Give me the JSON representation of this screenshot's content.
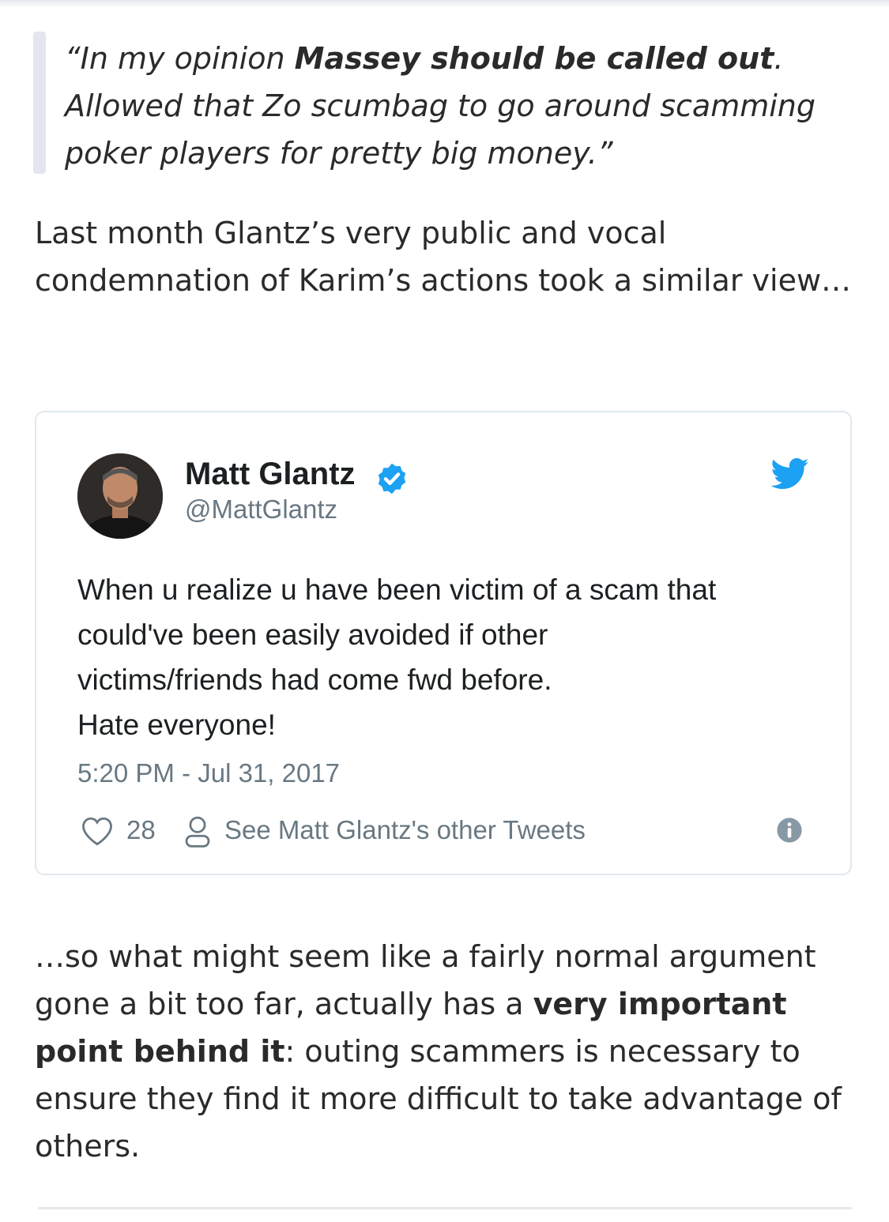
{
  "quote": {
    "open": "“In my opinion ",
    "bold": "Massey should be called out",
    "rest": ". Allowed that Zo scumbag to go around scamming poker players for pretty big money.”"
  },
  "para1": "Last month Glantz’s very public and vocal condemnation of Karim’s actions took a similar view…",
  "tweet": {
    "author_name": "Matt Glantz",
    "handle": "@MattGlantz",
    "lines": [
      "When u realize u have been victim of a scam that",
      "could've been easily avoided if other",
      "victims/friends had come fwd before.",
      "Hate everyone!"
    ],
    "timestamp": "5:20 PM - Jul 31, 2017",
    "like_count": "28",
    "other_tweets_label": "See Matt Glantz's other Tweets",
    "icons": {
      "verified": "verified-badge-icon",
      "brand": "twitter-bird-icon",
      "like": "heart-icon",
      "profile": "person-icon",
      "info": "info-icon"
    }
  },
  "para2": {
    "part1": "…so what might seem like a fairly normal argument gone a bit too far, actually has a ",
    "bold": "very important point behind it",
    "part2": ": outing scammers is necessary to ensure they find it more difficult to take advantage of others."
  },
  "colors": {
    "twitter_blue": "#1da1f2",
    "muted_text": "#697882",
    "border": "#e1e8ed",
    "quote_bar": "#e3e6ee"
  }
}
